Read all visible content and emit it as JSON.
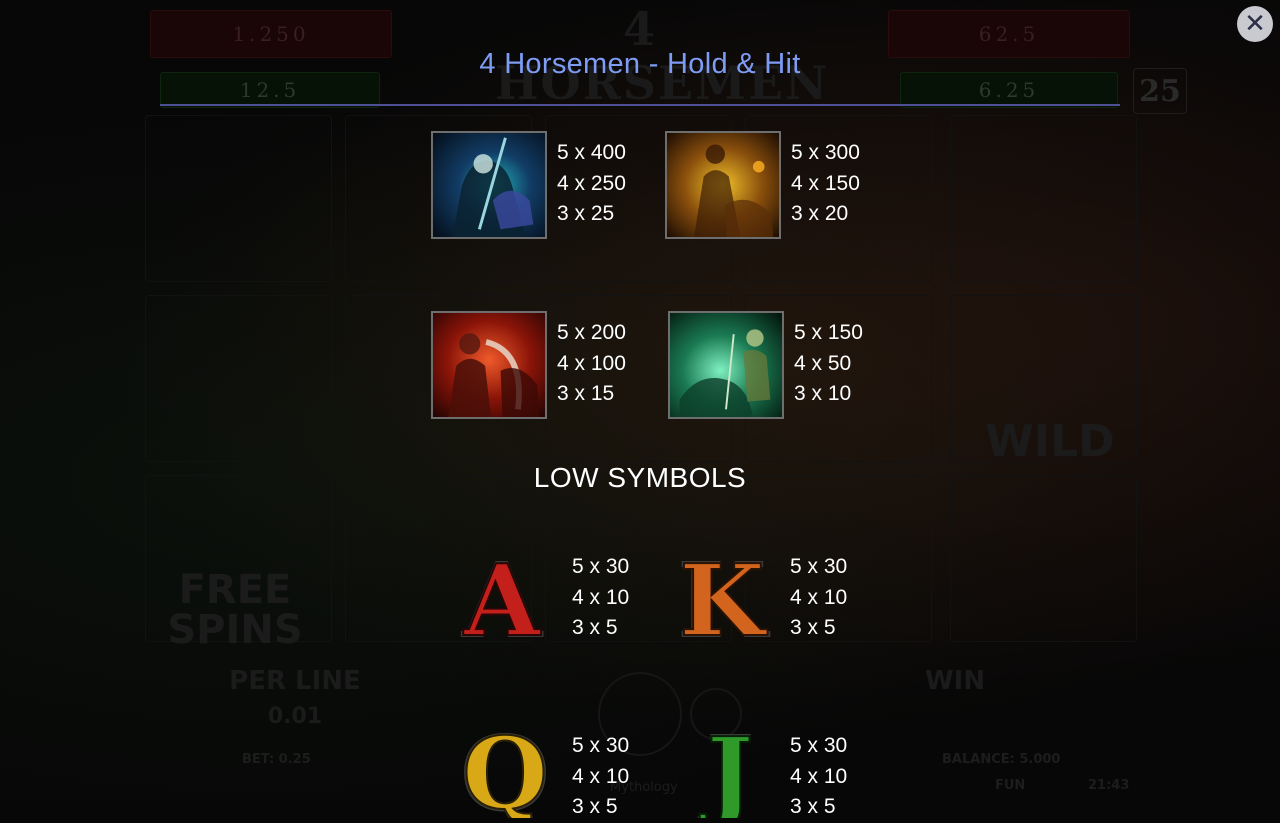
{
  "background_game": {
    "stats_left": [
      "1.250",
      "12.5"
    ],
    "stats_right": [
      "62.5",
      "6.25"
    ],
    "logo_text": "4 HORSEMEN",
    "lines_count": "25",
    "wild_label": "WILD",
    "free_spins_label": "FREE SPINS",
    "per_line_label": "PER LINE",
    "per_line_value": "0.01",
    "win_label": "WIN",
    "bet_label": "BET: 0.25",
    "balance_label": "BALANCE: 5.000",
    "mode_label": "FUN",
    "clock": "21:43",
    "brand": "Mythology"
  },
  "paytable": {
    "title": "4 Horsemen - Hold & Hit",
    "close_icon": "close-icon",
    "high_symbols": [
      {
        "name": "death-horseman-icon",
        "pays": [
          "5 x 400",
          "4 x 250",
          "3 x 25"
        ],
        "accent": "#1fb3b8"
      },
      {
        "name": "famine-horseman-icon",
        "pays": [
          "5 x 300",
          "4 x 150",
          "3 x 20"
        ],
        "accent": "#e0a21a"
      },
      {
        "name": "war-horseman-icon",
        "pays": [
          "5 x 200",
          "4 x 100",
          "3 x 15"
        ],
        "accent": "#d8321c"
      },
      {
        "name": "pestilence-horseman-icon",
        "pays": [
          "5 x 150",
          "4 x 50",
          "3 x 10"
        ],
        "accent": "#2bc58a"
      }
    ],
    "low_label": "LOW SYMBOLS",
    "low_symbols": [
      {
        "name": "letter-a-icon",
        "glyph": "A",
        "pays": [
          "5 x 30",
          "4 x 10",
          "3 x 5"
        ],
        "color": "#c3201c"
      },
      {
        "name": "letter-k-icon",
        "glyph": "K",
        "pays": [
          "5 x 30",
          "4 x 10",
          "3 x 5"
        ],
        "color": "#d2641e"
      },
      {
        "name": "letter-q-icon",
        "glyph": "Q",
        "pays": [
          "5 x 30",
          "4 x 10",
          "3 x 5"
        ],
        "color": "#d9a817"
      },
      {
        "name": "letter-j-icon",
        "glyph": "J",
        "pays": [
          "5 x 30",
          "4 x 10",
          "3 x 5"
        ],
        "color": "#2f9a2a"
      }
    ]
  }
}
